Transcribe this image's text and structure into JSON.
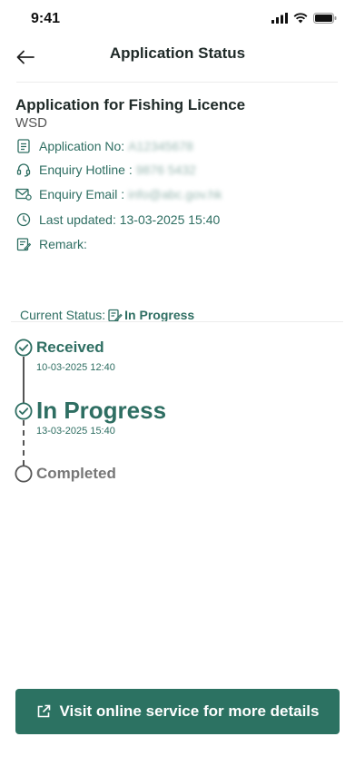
{
  "status_bar": {
    "time": "9:41"
  },
  "nav": {
    "title": "Application Status"
  },
  "application": {
    "title": "Application for Fishing Licence",
    "department": "WSD",
    "app_no_label": "Application No:",
    "app_no_value": "A12345678",
    "hotline_label": "Enquiry Hotline :",
    "hotline_value": "9876 5432",
    "email_label": "Enquiry Email :",
    "email_value": "info@abc.gov.hk",
    "last_updated": "Last updated: 13-03-2025 15:40",
    "remark_label": "Remark:"
  },
  "current_status": {
    "label": "Current Status:",
    "value": "In Progress"
  },
  "timeline": [
    {
      "label": "Received",
      "date": "10-03-2025 12:40",
      "state": "done"
    },
    {
      "label": "In Progress",
      "date": "13-03-2025 15:40",
      "state": "current"
    },
    {
      "label": "Completed",
      "date": "",
      "state": "pending"
    }
  ],
  "cta": {
    "label": "Visit online service for more details"
  },
  "colors": {
    "accent": "#2c7262",
    "text_accent": "#2e6e62",
    "pending": "#777777"
  }
}
